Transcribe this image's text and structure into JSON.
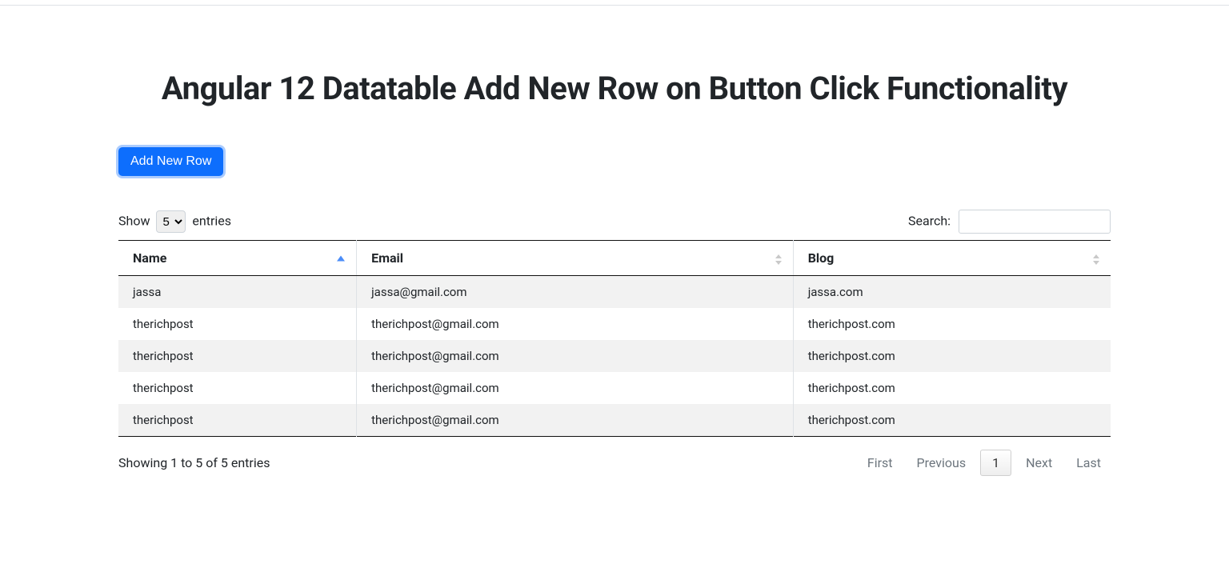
{
  "title": "Angular 12 Datatable Add New Row on Button Click Functionality",
  "add_button_label": "Add New Row",
  "length": {
    "show_label": "Show",
    "entries_label": "entries",
    "selected": "5"
  },
  "search": {
    "label": "Search:",
    "value": ""
  },
  "columns": {
    "name": "Name",
    "email": "Email",
    "blog": "Blog"
  },
  "rows": [
    {
      "name": "jassa",
      "email": "jassa@gmail.com",
      "blog": "jassa.com"
    },
    {
      "name": "therichpost",
      "email": "therichpost@gmail.com",
      "blog": "therichpost.com"
    },
    {
      "name": "therichpost",
      "email": "therichpost@gmail.com",
      "blog": "therichpost.com"
    },
    {
      "name": "therichpost",
      "email": "therichpost@gmail.com",
      "blog": "therichpost.com"
    },
    {
      "name": "therichpost",
      "email": "therichpost@gmail.com",
      "blog": "therichpost.com"
    }
  ],
  "info_text": "Showing 1 to 5 of 5 entries",
  "pager": {
    "first": "First",
    "previous": "Previous",
    "current": "1",
    "next": "Next",
    "last": "Last"
  }
}
